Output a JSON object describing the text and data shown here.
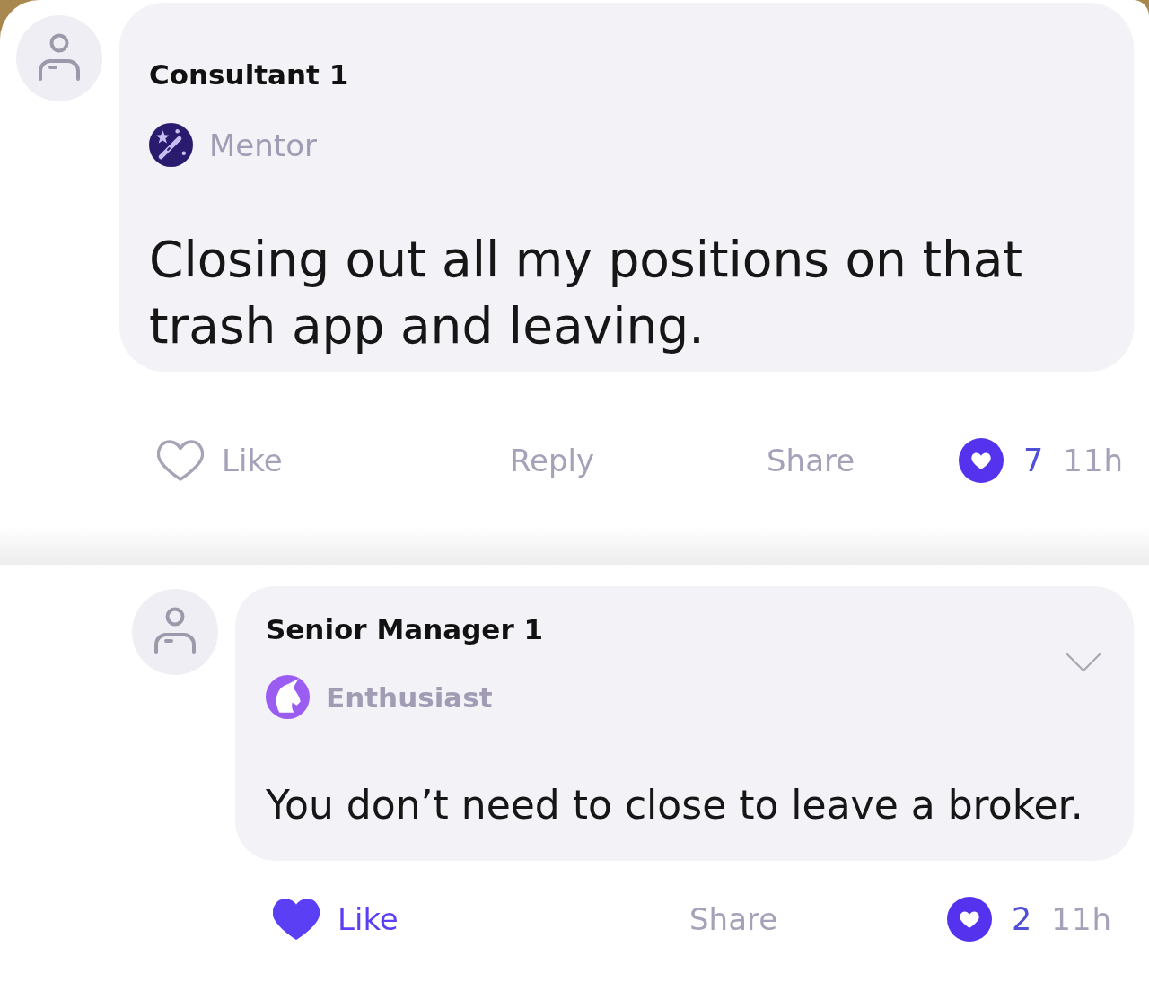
{
  "comments": [
    {
      "author": "Consultant 1",
      "badge": {
        "kind": "mentor",
        "label": "Mentor"
      },
      "text": "Closing out all my positions on that trash app and leaving.",
      "collapsible": false,
      "like": {
        "label": "Like",
        "liked": false
      },
      "reply": {
        "label": "Reply"
      },
      "share": {
        "label": "Share"
      },
      "like_count": "7",
      "time": "11h",
      "children": [
        {
          "author": "Senior Manager 1",
          "badge": {
            "kind": "enthusiast",
            "label": "Enthusiast"
          },
          "text": "You don’t need to close to leave a broker.",
          "collapsible": true,
          "like": {
            "label": "Like",
            "liked": true
          },
          "share": {
            "label": "Share"
          },
          "like_count": "2",
          "time": "11h"
        }
      ]
    }
  ]
}
